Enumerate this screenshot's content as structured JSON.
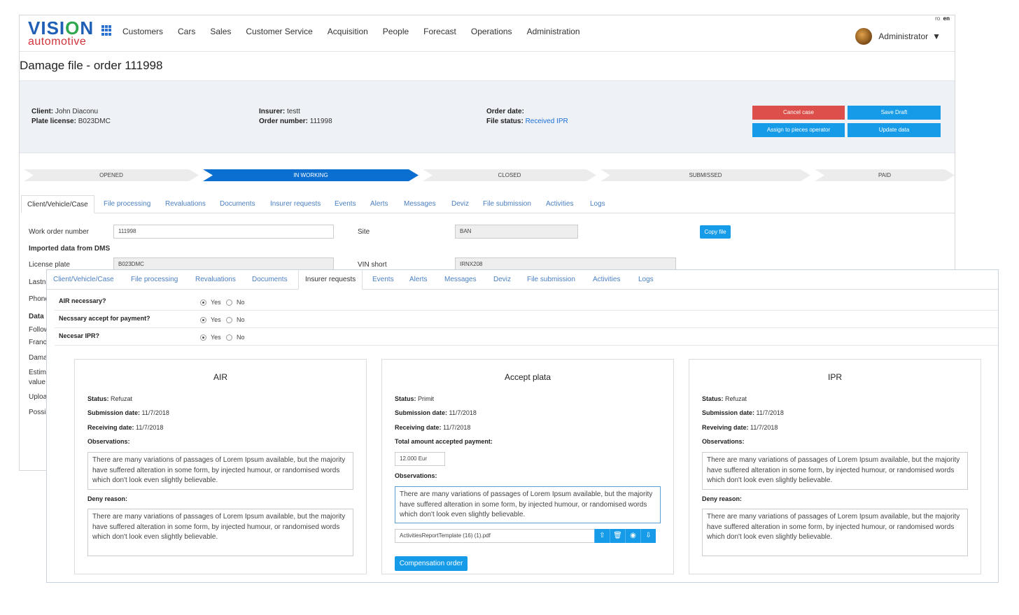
{
  "lang": {
    "ro": "ro",
    "en": "en"
  },
  "logo": {
    "word1a": "VISI",
    "word1b": "O",
    "word1c": "N",
    "word2": "automotive"
  },
  "nav": [
    "Customers",
    "Cars",
    "Sales",
    "Customer Service",
    "Acquisition",
    "People",
    "Forecast",
    "Operations",
    "Administration"
  ],
  "user": {
    "name": "Administrator"
  },
  "page": {
    "title": "Damage file - order 111998"
  },
  "info": {
    "client_label": "Client:",
    "client": "John Diaconu",
    "plate_label": "Plate license:",
    "plate": "B023DMC",
    "insurer_label": "Insurer:",
    "insurer": "testt",
    "order_number_label": "Order number:",
    "order_number": "111998",
    "order_date_label": "Order date:",
    "order_date": "",
    "file_status_label": "File status:",
    "file_status": "Received IPR"
  },
  "actions": {
    "cancel": "Cancel case",
    "save": "Save Draft",
    "assign": "Assign to pieces operator",
    "update": "Update data"
  },
  "steps": [
    "OPENED",
    "IN WORKING",
    "CLOSED",
    "SUBMISSED",
    "PAID"
  ],
  "tabs": [
    "Client/Vehicle/Case",
    "File processing",
    "Revaluations",
    "Documents",
    "Insurer requests",
    "Events",
    "Alerts",
    "Messages",
    "Deviz",
    "File submission",
    "Activities",
    "Logs"
  ],
  "back_form": {
    "work_order_label": "Work order number",
    "work_order": "111998",
    "site_label": "Site",
    "site": "BAN",
    "copy_file": "Copy file",
    "imported": "Imported data from DMS",
    "license_label": "License plate",
    "license": "B023DMC",
    "vin_label": "VIN short",
    "vin": "IRNX208",
    "partial_labels": [
      "Lastn",
      "Phone",
      "Data c",
      "Follow",
      "Franc",
      "Dama",
      "Estim",
      "value",
      "Uploa",
      "Possi"
    ]
  },
  "questions": [
    {
      "label": "AIR necessary?",
      "yes": "Yes",
      "no": "No"
    },
    {
      "label": "Necssary accept for payment?",
      "yes": "Yes",
      "no": "No"
    },
    {
      "label": "Necesar IPR?",
      "yes": "Yes",
      "no": "No"
    }
  ],
  "cards": {
    "air": {
      "title": "AIR",
      "status_label": "Status:",
      "status": "Refuzat",
      "sub_label": "Submission date:",
      "sub": "11/7/2018",
      "rec_label": "Receiving date:",
      "rec": "11/7/2018",
      "obs_label": "Observations:",
      "obs": "There are many variations of passages of Lorem Ipsum available, but the majority have suffered alteration in some form, by injected humour, or randomised words which don't look even slightly believable.",
      "deny_label": "Deny reason:",
      "deny": "There are many variations of passages of Lorem Ipsum available, but the majority have suffered alteration in some form, by injected humour, or randomised words which don't look even slightly believable."
    },
    "accept": {
      "title": "Accept plata",
      "status_label": "Status:",
      "status": "Primit",
      "sub_label": "Submission date:",
      "sub": "11/7/2018",
      "rec_label": "Receiving date:",
      "rec": "11/7/2018",
      "total_label": "Total amount accepted payment:",
      "total": "12.000 Eur",
      "obs_label": "Observations:",
      "obs": "There are many variations of passages of Lorem Ipsum available, but the majority have suffered alteration in some form, by injected humour, or randomised words which don't look even slightly believable.",
      "file": "ActivitiesReportTemplate (16) (1).pdf",
      "comp": "Compensation order"
    },
    "ipr": {
      "title": "IPR",
      "status_label": "Status:",
      "status": "Refuzat",
      "sub_label": "Submission date:",
      "sub": "11/7/2018",
      "rec_label": "Reveiving date:",
      "rec": "11/7/2018",
      "obs_label": "Observations:",
      "obs": "There are many variations of passages of Lorem Ipsum available, but the majority have suffered alteration in some form, by injected humour, or randomised words which don't look even slightly believable.",
      "deny_label": "Deny reason:",
      "deny": "There are many variations of passages of Lorem Ipsum available, but the majority have suffered alteration in some form, by injected humour, or randomised words which don't look even slightly believable."
    }
  },
  "colors": {
    "primary": "#169be8",
    "danger": "#dd4f4a",
    "step_active": "#0a6fd1",
    "link": "#4a7fc1"
  },
  "icons": [
    "apps-grid-icon",
    "upload-icon",
    "trash-icon",
    "eye-icon",
    "download-icon",
    "chevron-down-icon"
  ]
}
